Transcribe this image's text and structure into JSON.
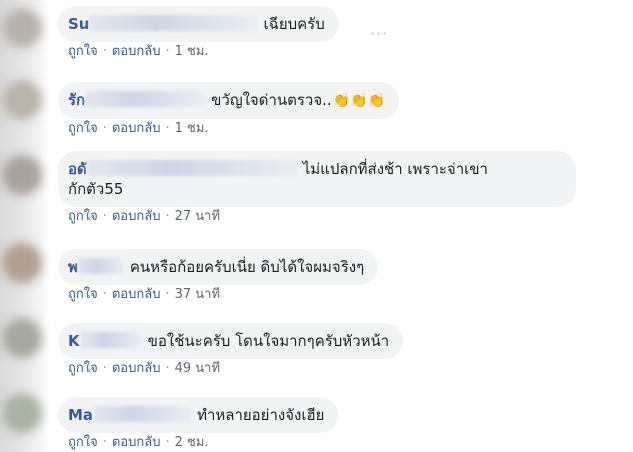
{
  "comments": [
    {
      "name_prefix": "Su",
      "text": "เฉียบครับ",
      "like_label": "ถูกใจ",
      "reply_label": "ตอบกลับ",
      "time": "1 ชม.",
      "more_label": "···"
    },
    {
      "name_prefix": "รัก",
      "text": "ขวัญใจด่านตรวจ..",
      "emoji": "👏👏👏",
      "like_label": "ถูกใจ",
      "reply_label": "ตอบกลับ",
      "time": "1 ชม."
    },
    {
      "name_prefix": "อดั",
      "text": "ไม่แปลกที่ส่งช้า เพราะจ่าเขา",
      "text_line2": "กักตัว55",
      "like_label": "ถูกใจ",
      "reply_label": "ตอบกลับ",
      "time": "27 นาที"
    },
    {
      "name_prefix": "พ",
      "text": "คนหรือก้อยครับเนี่ย ดิบได้ใจผมจริงๆ",
      "like_label": "ถูกใจ",
      "reply_label": "ตอบกลับ",
      "time": "37 นาที"
    },
    {
      "name_prefix": "K",
      "text": "ขอใช้นะครับ โดนใจมากๆครับหัวหน้า",
      "like_label": "ถูกใจ",
      "reply_label": "ตอบกลับ",
      "time": "49 นาที"
    },
    {
      "name_prefix": "Ma",
      "text": "ทำหลายอย่างจังเฮีย",
      "like_label": "ถูกใจ",
      "reply_label": "ตอบกลับ",
      "time": "2 ชม."
    }
  ],
  "colors": {
    "name": "#385898",
    "bubble": "#f2f3f5",
    "meta": "#606770"
  }
}
